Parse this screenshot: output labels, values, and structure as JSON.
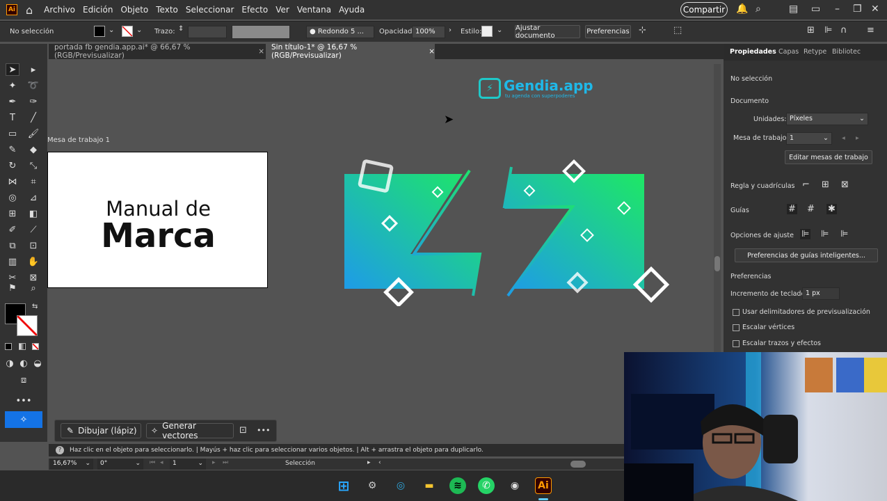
{
  "menubar": {
    "logo": "Ai",
    "items": [
      "Archivo",
      "Edición",
      "Objeto",
      "Texto",
      "Seleccionar",
      "Efecto",
      "Ver",
      "Ventana",
      "Ayuda"
    ],
    "share_label": "Compartir"
  },
  "control": {
    "selection": "No selección",
    "stroke_label": "Trazo:",
    "brush": "Redondo 5 ...",
    "opacity_label": "Opacidad:",
    "opacity_value": "100%",
    "style_label": "Estilo:",
    "doc_button": "Ajustar documento",
    "prefs_button": "Preferencias"
  },
  "tabs": [
    {
      "label": "portada fb gendia.app.ai* @ 66,67 % (RGB/Previsualizar)",
      "close": "×"
    },
    {
      "label": "Sin título-1* @ 16,67 % (RGB/Previsualizar)",
      "close": "×"
    }
  ],
  "canvas": {
    "artboard_label": "Mesa de trabajo 1",
    "artboard_line1": "Manual de",
    "artboard_line2": "Marca",
    "logo_text": "Gendia.app",
    "logo_tagline": "tu agenda con superpoderes"
  },
  "context_bar": {
    "draw_label": "Dibujar (lápiz)",
    "vector_label": "Generar vectores",
    "more": "•••"
  },
  "properties": {
    "tabs": [
      "Propiedades",
      "Capas",
      "Retype",
      "Bibliotec"
    ],
    "no_selection": "No selección",
    "document": "Documento",
    "units_label": "Unidades:",
    "units_value": "Píxeles",
    "artboard_label": "Mesa de trabajo:",
    "artboard_value": "1",
    "edit_artboards": "Editar mesas de trabajo",
    "rulers": "Regla y cuadrículas",
    "guides": "Guías",
    "snap": "Opciones de ajuste",
    "smart_guides": "Preferencias de guías inteligentes...",
    "prefs": "Preferencias",
    "keyboard_inc_label": "Incremento de teclado:",
    "keyboard_inc_value": "1 px",
    "checks": [
      "Usar delimitadores de previsualización",
      "Escalar vértices",
      "Escalar trazos y efectos"
    ]
  },
  "status": {
    "hint": "Haz clic en el objeto para seleccionarlo.  |  Mayús + haz clic para seleccionar varios objetos.  |  Alt + arrastra el objeto para duplicarlo.",
    "zoom": "16,67%",
    "rotation": "0°",
    "artboard_num": "1",
    "tool": "Selección"
  },
  "colors": {
    "gradient_start": "#1e9be8",
    "gradient_end": "#1ee864",
    "accent": "#1473e6"
  }
}
